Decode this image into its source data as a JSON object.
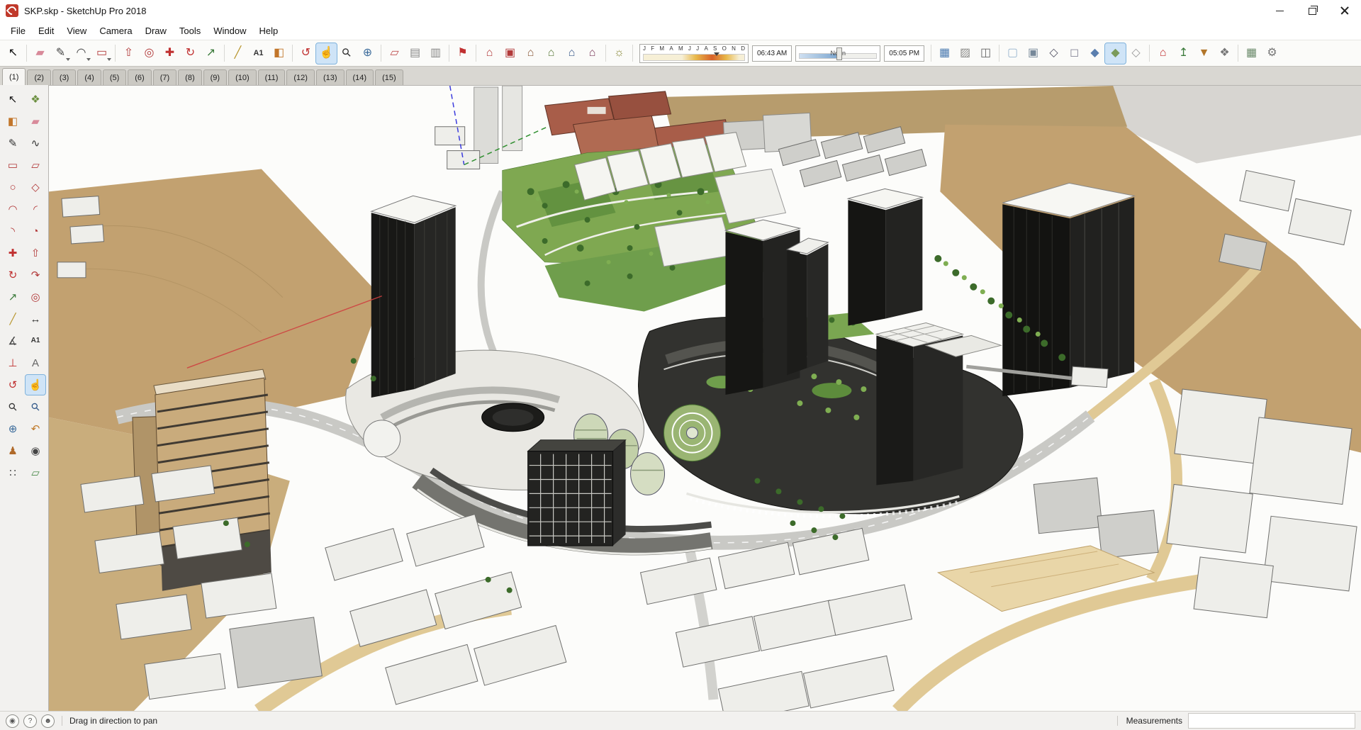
{
  "window": {
    "title": "SKP.skp - SketchUp Pro 2018"
  },
  "menu": {
    "items": [
      "File",
      "Edit",
      "View",
      "Camera",
      "Draw",
      "Tools",
      "Window",
      "Help"
    ]
  },
  "main_toolbar": {
    "groups": [
      {
        "items": [
          {
            "name": "select",
            "glyph": "↖",
            "color": "#111"
          }
        ]
      },
      {
        "items": [
          {
            "name": "eraser",
            "glyph": "▰",
            "color": "#d88a9a"
          },
          {
            "name": "lines",
            "glyph": "✎",
            "color": "#444",
            "dropdown": true
          },
          {
            "name": "arcs",
            "glyph": "◠",
            "color": "#444",
            "dropdown": true
          },
          {
            "name": "shapes",
            "glyph": "▭",
            "color": "#b23a3a",
            "dropdown": true
          }
        ]
      },
      {
        "items": [
          {
            "name": "push-pull",
            "glyph": "⇧",
            "color": "#b23a3a"
          },
          {
            "name": "offset",
            "glyph": "◎",
            "color": "#b23a3a"
          },
          {
            "name": "move",
            "glyph": "✚",
            "color": "#c03030"
          },
          {
            "name": "rotate",
            "glyph": "↻",
            "color": "#c03030"
          },
          {
            "name": "scale",
            "glyph": "↗",
            "color": "#3a7a3a"
          }
        ]
      },
      {
        "items": [
          {
            "name": "tape-measure",
            "glyph": "╱",
            "color": "#b8962e"
          },
          {
            "name": "text",
            "glyph": "A1",
            "color": "#333",
            "small": true
          },
          {
            "name": "paint-bucket",
            "glyph": "◧",
            "color": "#c2762a"
          }
        ]
      },
      {
        "items": [
          {
            "name": "orbit",
            "glyph": "↺",
            "color": "#c03030"
          },
          {
            "name": "pan",
            "glyph": "☝",
            "color": "#c8a04a",
            "active": true
          },
          {
            "name": "zoom",
            "glyph": "⚲",
            "color": "#333",
            "rotate": -45
          },
          {
            "name": "zoom-extents",
            "glyph": "⊕",
            "color": "#3a6a9a"
          }
        ]
      },
      {
        "items": [
          {
            "name": "section-plane",
            "glyph": "▱",
            "color": "#c05050"
          },
          {
            "name": "display-section-planes",
            "glyph": "▤",
            "color": "#888"
          },
          {
            "name": "display-section-cuts",
            "glyph": "▥",
            "color": "#888"
          }
        ]
      },
      {
        "items": [
          {
            "name": "add-location",
            "glyph": "⚑",
            "color": "#c03030"
          }
        ]
      },
      {
        "items": [
          {
            "name": "view-iso",
            "glyph": "⌂",
            "color": "#b23a3a"
          },
          {
            "name": "view-top",
            "glyph": "▣",
            "color": "#b23a3a"
          },
          {
            "name": "view-front",
            "glyph": "⌂",
            "color": "#8a5a3a"
          },
          {
            "name": "view-right",
            "glyph": "⌂",
            "color": "#5a7a3a"
          },
          {
            "name": "view-back",
            "glyph": "⌂",
            "color": "#3a5a8a"
          },
          {
            "name": "view-left",
            "glyph": "⌂",
            "color": "#7a3a5a"
          }
        ]
      },
      {
        "items": [
          {
            "name": "shadows-toggle",
            "glyph": "☼",
            "color": "#8a8a3a"
          }
        ]
      },
      {
        "type": "shadow"
      },
      {
        "items": [
          {
            "name": "toggle-terrain",
            "glyph": "▦",
            "color": "#4a7ab0"
          },
          {
            "name": "photo-textures",
            "glyph": "▨",
            "color": "#8a8a88"
          },
          {
            "name": "model-info",
            "glyph": "◫",
            "color": "#666"
          }
        ]
      },
      {
        "items": [
          {
            "name": "x-ray",
            "glyph": "▢",
            "color": "#9ab6d0"
          },
          {
            "name": "back-edges",
            "glyph": "▣",
            "color": "#778899"
          },
          {
            "name": "wireframe",
            "glyph": "◇",
            "color": "#556"
          },
          {
            "name": "hidden-line",
            "glyph": "◻",
            "color": "#889"
          },
          {
            "name": "shaded",
            "glyph": "◆",
            "color": "#5b7fae"
          },
          {
            "name": "shaded-with-textures",
            "glyph": "◆",
            "color": "#7a9a5a",
            "active": true
          },
          {
            "name": "monochrome",
            "glyph": "◇",
            "color": "#999"
          }
        ]
      },
      {
        "items": [
          {
            "name": "3d-warehouse",
            "glyph": "⌂",
            "color": "#c03030"
          },
          {
            "name": "share-model",
            "glyph": "↥",
            "color": "#3a7a3a"
          },
          {
            "name": "extension-warehouse",
            "glyph": "▼",
            "color": "#b2762a"
          },
          {
            "name": "extension-manager",
            "glyph": "❖",
            "color": "#777"
          }
        ]
      },
      {
        "items": [
          {
            "name": "generate-report",
            "glyph": "▦",
            "color": "#6a8a6a"
          },
          {
            "name": "preferences",
            "glyph": "⚙",
            "color": "#777"
          }
        ]
      }
    ]
  },
  "shadows": {
    "months": [
      "J",
      "F",
      "M",
      "A",
      "M",
      "J",
      "J",
      "A",
      "S",
      "O",
      "N",
      "D"
    ],
    "time_start": "06:43 AM",
    "time_mid": "Noon",
    "time_end": "05:05 PM"
  },
  "scene_tabs": {
    "labels": [
      "(1)",
      "(2)",
      "(3)",
      "(4)",
      "(5)",
      "(6)",
      "(7)",
      "(8)",
      "(9)",
      "(10)",
      "(11)",
      "(12)",
      "(13)",
      "(14)",
      "(15)"
    ],
    "active_index": 0
  },
  "left_toolbar": {
    "tools": [
      {
        "name": "select",
        "glyph": "↖",
        "color": "#111"
      },
      {
        "name": "make-component",
        "glyph": "❖",
        "color": "#6b8f3f"
      },
      {
        "name": "paint-bucket",
        "glyph": "◧",
        "color": "#c2762a"
      },
      {
        "name": "eraser",
        "glyph": "▰",
        "color": "#d88a9a"
      },
      {
        "name": "line",
        "glyph": "✎",
        "color": "#333"
      },
      {
        "name": "freehand",
        "glyph": "∿",
        "color": "#333"
      },
      {
        "name": "rectangle",
        "glyph": "▭",
        "color": "#b23a3a"
      },
      {
        "name": "rotated-rectangle",
        "glyph": "▱",
        "color": "#b23a3a"
      },
      {
        "name": "circle",
        "glyph": "○",
        "color": "#b23a3a"
      },
      {
        "name": "polygon",
        "glyph": "◇",
        "color": "#b23a3a"
      },
      {
        "name": "arc",
        "glyph": "◠",
        "color": "#b23a3a"
      },
      {
        "name": "two-point-arc",
        "glyph": "◜",
        "color": "#b23a3a"
      },
      {
        "name": "three-point-arc",
        "glyph": "◝",
        "color": "#b23a3a"
      },
      {
        "name": "pie",
        "glyph": "◔",
        "color": "#b23a3a"
      },
      {
        "name": "move",
        "glyph": "✚",
        "color": "#c03030"
      },
      {
        "name": "push-pull",
        "glyph": "⇧",
        "color": "#b23a3a"
      },
      {
        "name": "rotate",
        "glyph": "↻",
        "color": "#c03030"
      },
      {
        "name": "follow-me",
        "glyph": "↷",
        "color": "#b23a3a"
      },
      {
        "name": "scale",
        "glyph": "↗",
        "color": "#3a7a3a"
      },
      {
        "name": "offset",
        "glyph": "◎",
        "color": "#b23a3a"
      },
      {
        "name": "tape-measure",
        "glyph": "╱",
        "color": "#b8962e"
      },
      {
        "name": "dimension",
        "glyph": "↔",
        "color": "#333"
      },
      {
        "name": "protractor",
        "glyph": "∡",
        "color": "#444"
      },
      {
        "name": "text",
        "glyph": "A1",
        "color": "#333",
        "small": true
      },
      {
        "name": "axes",
        "glyph": "⊥",
        "color": "#c03030"
      },
      {
        "name": "three-d-text",
        "glyph": "A",
        "color": "#666"
      },
      {
        "name": "orbit",
        "glyph": "↺",
        "color": "#c03030"
      },
      {
        "name": "pan",
        "glyph": "☝",
        "color": "#c8a04a",
        "active": true
      },
      {
        "name": "zoom",
        "glyph": "⚲",
        "color": "#333",
        "rotate": -45
      },
      {
        "name": "zoom-window",
        "glyph": "⚲",
        "color": "#335a8a",
        "rotate": -45
      },
      {
        "name": "zoom-extents",
        "glyph": "⊕",
        "color": "#3a6a9a"
      },
      {
        "name": "previous",
        "glyph": "↶",
        "color": "#c07a2a"
      },
      {
        "name": "position-camera",
        "glyph": "♟",
        "color": "#b06a2a"
      },
      {
        "name": "look-around",
        "glyph": "◉",
        "color": "#444"
      },
      {
        "name": "walk",
        "glyph": "∷",
        "color": "#555"
      },
      {
        "name": "section-plane-tool",
        "glyph": "▱",
        "color": "#4a8a4a"
      }
    ]
  },
  "status_bar": {
    "icons": [
      {
        "name": "geolocation-icon",
        "glyph": "◉"
      },
      {
        "name": "help-icon",
        "glyph": "?"
      },
      {
        "name": "sign-in-icon",
        "glyph": "☻"
      }
    ],
    "hint": "Drag in direction to pan",
    "measurements_label": "Measurements",
    "measurements_value": ""
  }
}
